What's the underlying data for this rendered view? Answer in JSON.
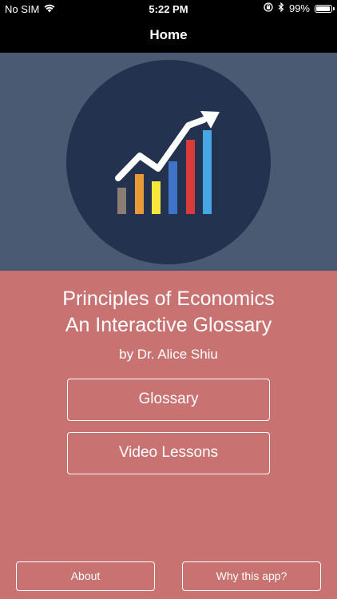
{
  "status_bar": {
    "carrier": "No SIM",
    "time": "5:22 PM",
    "battery_percent": "99%",
    "battery_level": 0.99,
    "icons": [
      "wifi-icon",
      "orientation-lock-icon",
      "bluetooth-icon",
      "battery-icon"
    ]
  },
  "nav": {
    "title": "Home"
  },
  "hero": {
    "icon": "rising-bar-chart-logo",
    "circle_color": "#22324f",
    "background_color": "#4a5a72",
    "bar_colors": [
      "#8a7e74",
      "#e79a3a",
      "#f6e73a",
      "#3f73c6",
      "#d93a3a",
      "#46a6e6"
    ]
  },
  "main": {
    "title_line1": "Principles of Economics",
    "title_line2": "An Interactive Glossary",
    "byline": "by Dr. Alice Shiu",
    "glossary_label": "Glossary",
    "video_label": "Video Lessons",
    "background_color": "#c87371"
  },
  "footer": {
    "about_label": "About",
    "why_label": "Why this app?"
  }
}
